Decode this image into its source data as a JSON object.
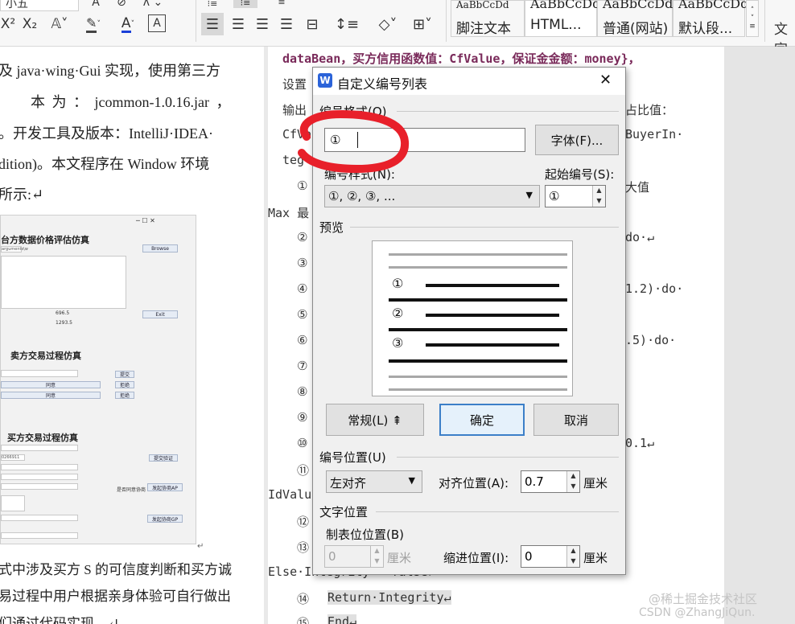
{
  "ribbon": {
    "font_size_label": "小五",
    "superscript": "X²",
    "subscript": "X₂",
    "char_A": "A",
    "style_gallery": [
      {
        "preview": "AaBbCcDd",
        "name": "脚注文本"
      },
      {
        "preview": "AaBbCcDd",
        "name": "HTML..."
      },
      {
        "preview": "AaBbCcDd",
        "name": "普通(网站)"
      },
      {
        "preview": "AaBbCcDd",
        "name": "默认段..."
      }
    ],
    "text_tool_label": "文字"
  },
  "left_page": {
    "lines": [
      "及 java·wing·Gui 实现，使用第三方",
      "本 为 ： jcommon-1.0.16.jar ，",
      "。开发工具及版本：IntelliJ·IDEA·",
      "dition)。本文程序在 Window 环境",
      "所示:↵"
    ],
    "bottom_lines": [
      "式中涉及买方 S 的可信度判断和买方诚",
      "易过程中用户根据亲身体验可自行做出",
      "们通过代码实现。↵"
    ],
    "embedded_app": {
      "title1": "台方数据价格评估仿真",
      "title2": "卖方交易过程仿真",
      "title3": "买方交易过程仿真",
      "browse_button": "Browse",
      "exit_button": "Exit",
      "value1": "696.5",
      "value2": "1293.5",
      "btn_submit": "提交",
      "btn_reject": "拒绝",
      "btn_agree": "同意",
      "btn_submit_verify": "提交验证",
      "btn_agree_ap": "发起协商AP",
      "btn_agree_gp": "发起协商GP",
      "label_is_agree": "是否同意协商",
      "input_value": "arguments\\w",
      "input_value2": "0266911"
    }
  },
  "right_page": {
    "code_lines": [
      "dataBean，买方信用函数值：CfValue，保证金金额：money}，",
      "设置",
      "输出",
      "CfVa",
      "teg"
    ],
    "right_frag": [
      "占比值：",
      "BuyerIn·",
      "大值",
      "do·↵",
      "1.2)·do·",
      ".5)·do·",
      "0.1↵"
    ],
    "max_line": "Max 最",
    "idvalu": "IdValu",
    "else_line": "Else·Integrity···false↵",
    "return_line": "Return·Integrity↵",
    "end_line": "End↵",
    "numbers": [
      "①",
      "②",
      "③",
      "④",
      "⑤",
      "⑥",
      "⑦",
      "⑧",
      "⑨",
      "⑩",
      "⑪",
      "⑫",
      "⑬",
      "⑭",
      "⑮"
    ]
  },
  "dialog": {
    "title": "自定义编号列表",
    "close": "✕",
    "number_format_label": "编号格式(O)",
    "number_format_value": "①",
    "font_button": "字体(F)...",
    "number_style_label": "编号样式(N):",
    "number_style_value": "①, ②, ③, ...",
    "start_at_label": "起始编号(S):",
    "start_at_value": "①",
    "preview_label": "预览",
    "preview_numbers": [
      "①",
      "②",
      "③"
    ],
    "normal_button": "常规(L) ⇞",
    "ok_button": "确定",
    "cancel_button": "取消",
    "number_position_label": "编号位置(U)",
    "alignment_value": "左对齐",
    "align_at_label": "对齐位置(A):",
    "align_at_value": "0.7",
    "align_unit": "厘米",
    "text_position_label": "文字位置",
    "tab_stop_label": "制表位位置(B)",
    "tab_stop_value": "0",
    "tab_unit": "厘米",
    "indent_label": "缩进位置(I):",
    "indent_value": "0",
    "indent_unit": "厘米"
  },
  "watermark": {
    "line1": "@稀土掘金技术社区",
    "line2": "CSDN @ZhangJiQun."
  },
  "colors": {
    "annotation_red": "#e8202a",
    "wps_blue": "#2b63d9",
    "primary_border": "#3c7fc8"
  }
}
